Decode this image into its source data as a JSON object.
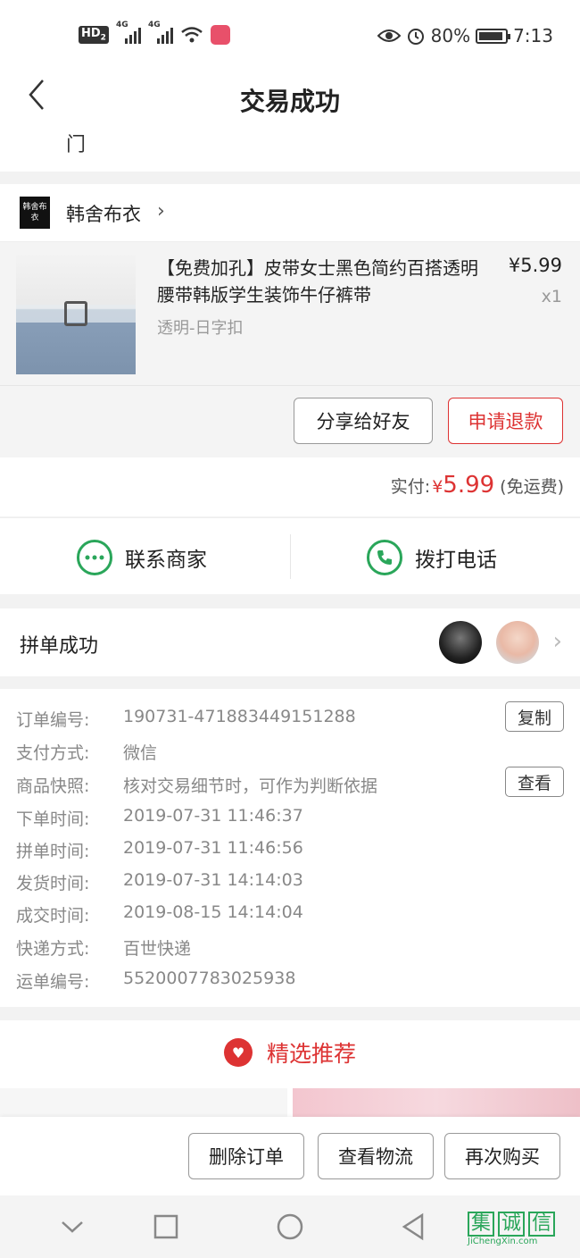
{
  "status_bar": {
    "hd_badge": "HD",
    "hd_sub": "2",
    "network1": "4G",
    "network2": "4G",
    "battery_pct": "80%",
    "time": "7:13",
    "icons": [
      "eye-icon",
      "alarm-icon",
      "battery-icon",
      "wifi-icon",
      "signal-icon"
    ]
  },
  "nav": {
    "title": "交易成功",
    "subtitle": "门"
  },
  "shop": {
    "logo_text": "韩舍布衣",
    "name": "韩舍布衣"
  },
  "product": {
    "title": "【免费加孔】皮带女士黑色简约百搭透明腰带韩版学生装饰牛仔裤带",
    "price": "¥5.99",
    "quantity": "x1",
    "spec": "透明-日字扣",
    "share_button": "分享给好友",
    "refund_button": "申请退款"
  },
  "payment": {
    "label": "实付:",
    "currency": "¥",
    "amount": "5.99",
    "note": "(免运费)"
  },
  "contact": {
    "merchant_label": "联系商家",
    "phone_label": "拨打电话"
  },
  "group": {
    "label": "拼单成功"
  },
  "order_details": {
    "rows": [
      {
        "key": "订单编号:",
        "value": "190731-471883449151288"
      },
      {
        "key": "支付方式:",
        "value": "微信"
      },
      {
        "key": "商品快照:",
        "value": "核对交易细节时，可作为判断依据"
      },
      {
        "key": "下单时间:",
        "value": "2019-07-31 11:46:37"
      },
      {
        "key": "拼单时间:",
        "value": "2019-07-31 11:46:56"
      },
      {
        "key": "发货时间:",
        "value": "2019-07-31 14:14:03"
      },
      {
        "key": "成交时间:",
        "value": "2019-08-15 14:14:04"
      },
      {
        "key": "快递方式:",
        "value": "百世快递"
      },
      {
        "key": "运单编号:",
        "value": "5520007783025938"
      }
    ],
    "copy_button": "复制",
    "view_button": "查看"
  },
  "recommend": {
    "title": "精选推荐"
  },
  "actions": {
    "delete": "删除订单",
    "logistics": "查看物流",
    "rebuy": "再次购买"
  },
  "watermark": {
    "chars": [
      "集",
      "诚",
      "信"
    ],
    "url": "JiChengXin.com"
  },
  "colors": {
    "accent_red": "#d33333",
    "green": "#2aa65a"
  }
}
